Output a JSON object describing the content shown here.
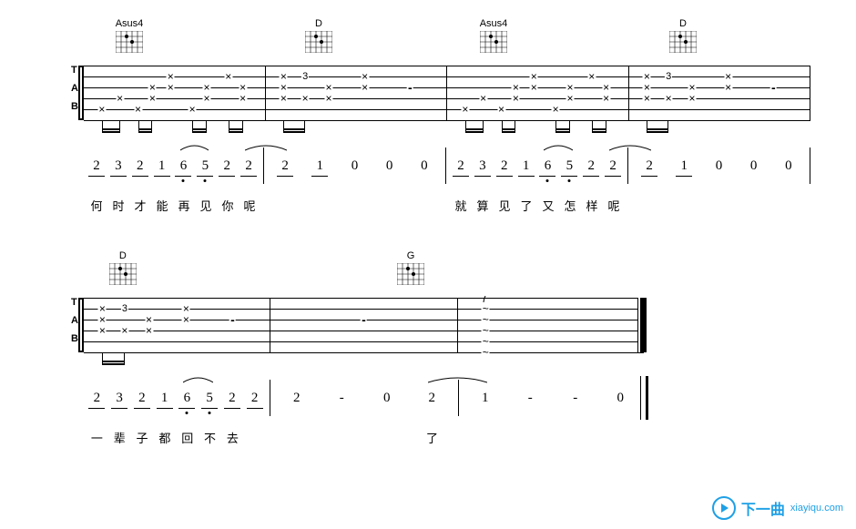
{
  "chart_data": {
    "type": "guitar_tab_with_jianpu",
    "systems": [
      {
        "chords": [
          {
            "position_pct": 4,
            "name": "Asus4"
          },
          {
            "position_pct": 30,
            "name": "D"
          },
          {
            "position_pct": 54,
            "name": "Asus4"
          },
          {
            "position_pct": 80,
            "name": "D"
          }
        ],
        "tab_measures": [
          {
            "marks": [
              {
                "x": 10,
                "string": 5,
                "t": "x"
              },
              {
                "x": 20,
                "string": 4,
                "t": "x"
              },
              {
                "x": 30,
                "string": 5,
                "t": "x"
              },
              {
                "x": 38,
                "string": 4,
                "t": "x"
              },
              {
                "x": 38,
                "string": 3,
                "t": "x"
              },
              {
                "x": 48,
                "string": 2,
                "t": "x"
              },
              {
                "x": 48,
                "string": 3,
                "t": "x"
              },
              {
                "x": 60,
                "string": 5,
                "t": "x"
              },
              {
                "x": 68,
                "string": 4,
                "t": "x"
              },
              {
                "x": 68,
                "string": 3,
                "t": "x"
              },
              {
                "x": 80,
                "string": 2,
                "t": "x"
              },
              {
                "x": 88,
                "string": 3,
                "t": "x"
              },
              {
                "x": 88,
                "string": 4,
                "t": "x"
              }
            ],
            "beams": [
              [
                10,
                20
              ],
              [
                30,
                38
              ],
              [
                60,
                68
              ],
              [
                80,
                88
              ]
            ]
          },
          {
            "marks": [
              {
                "x": 10,
                "string": 4,
                "t": "x"
              },
              {
                "x": 10,
                "string": 3,
                "t": "x"
              },
              {
                "x": 10,
                "string": 2,
                "t": "x"
              },
              {
                "x": 22,
                "string": 4,
                "t": "x"
              },
              {
                "x": 22,
                "string": 2,
                "t": "3"
              },
              {
                "x": 35,
                "string": 3,
                "t": "x"
              },
              {
                "x": 35,
                "string": 4,
                "t": "x"
              },
              {
                "x": 55,
                "string": 2,
                "t": "x"
              },
              {
                "x": 55,
                "string": 3,
                "t": "x"
              },
              {
                "x": 80,
                "string": 3,
                "t": "-"
              }
            ],
            "beams": [
              [
                10,
                22
              ]
            ]
          },
          {
            "marks": [
              {
                "x": 10,
                "string": 5,
                "t": "x"
              },
              {
                "x": 20,
                "string": 4,
                "t": "x"
              },
              {
                "x": 30,
                "string": 5,
                "t": "x"
              },
              {
                "x": 38,
                "string": 4,
                "t": "x"
              },
              {
                "x": 38,
                "string": 3,
                "t": "x"
              },
              {
                "x": 48,
                "string": 2,
                "t": "x"
              },
              {
                "x": 48,
                "string": 3,
                "t": "x"
              },
              {
                "x": 60,
                "string": 5,
                "t": "x"
              },
              {
                "x": 68,
                "string": 4,
                "t": "x"
              },
              {
                "x": 68,
                "string": 3,
                "t": "x"
              },
              {
                "x": 80,
                "string": 2,
                "t": "x"
              },
              {
                "x": 88,
                "string": 3,
                "t": "x"
              },
              {
                "x": 88,
                "string": 4,
                "t": "x"
              }
            ],
            "beams": [
              [
                10,
                20
              ],
              [
                30,
                38
              ],
              [
                60,
                68
              ],
              [
                80,
                88
              ]
            ]
          },
          {
            "marks": [
              {
                "x": 10,
                "string": 4,
                "t": "x"
              },
              {
                "x": 10,
                "string": 3,
                "t": "x"
              },
              {
                "x": 10,
                "string": 2,
                "t": "x"
              },
              {
                "x": 22,
                "string": 4,
                "t": "x"
              },
              {
                "x": 22,
                "string": 2,
                "t": "3"
              },
              {
                "x": 35,
                "string": 3,
                "t": "x"
              },
              {
                "x": 35,
                "string": 4,
                "t": "x"
              },
              {
                "x": 55,
                "string": 2,
                "t": "x"
              },
              {
                "x": 55,
                "string": 3,
                "t": "x"
              },
              {
                "x": 80,
                "string": 3,
                "t": "-"
              }
            ],
            "beams": [
              [
                10,
                22
              ]
            ]
          }
        ],
        "jianpu_measures": [
          {
            "notes": [
              {
                "n": "2",
                "u": 1
              },
              {
                "n": "3",
                "u": 1
              },
              {
                "n": "2",
                "u": 1
              },
              {
                "n": "1",
                "u": 1
              },
              {
                "n": "6",
                "u": 1,
                "low": 1,
                "tie_from": true
              },
              {
                "n": "5",
                "u": 1,
                "low": 1
              },
              {
                "n": "2",
                "u": 1
              },
              {
                "n": "2",
                "u": 1,
                "tie_to": true
              }
            ]
          },
          {
            "notes": [
              {
                "n": "2",
                "u": 1,
                "tie_from_prev": true
              },
              {
                "n": "1",
                "u": 1
              },
              {
                "n": "0"
              },
              {
                "n": "0"
              },
              {
                "n": "0"
              }
            ]
          },
          {
            "notes": [
              {
                "n": "2",
                "u": 1
              },
              {
                "n": "3",
                "u": 1
              },
              {
                "n": "2",
                "u": 1
              },
              {
                "n": "1",
                "u": 1
              },
              {
                "n": "6",
                "u": 1,
                "low": 1,
                "tie_from": true
              },
              {
                "n": "5",
                "u": 1,
                "low": 1
              },
              {
                "n": "2",
                "u": 1
              },
              {
                "n": "2",
                "u": 1,
                "tie_to": true
              }
            ]
          },
          {
            "notes": [
              {
                "n": "2",
                "u": 1,
                "tie_from_prev": true
              },
              {
                "n": "1",
                "u": 1
              },
              {
                "n": "0"
              },
              {
                "n": "0"
              },
              {
                "n": "0"
              }
            ]
          }
        ],
        "lyrics": [
          [
            "何",
            "时",
            "才",
            "能",
            "再",
            "见",
            "你",
            "呢"
          ],
          [
            "",
            "",
            "",
            "",
            ""
          ],
          [
            "就",
            "算",
            "见",
            "了",
            "又",
            "怎",
            "样",
            "呢"
          ],
          [
            "",
            "",
            "",
            "",
            ""
          ]
        ]
      },
      {
        "chords": [
          {
            "position_pct": 4,
            "name": "D"
          },
          {
            "position_pct": 55,
            "name": "G"
          }
        ],
        "tab_measures": [
          {
            "marks": [
              {
                "x": 10,
                "string": 4,
                "t": "x"
              },
              {
                "x": 10,
                "string": 3,
                "t": "x"
              },
              {
                "x": 10,
                "string": 2,
                "t": "x"
              },
              {
                "x": 22,
                "string": 4,
                "t": "x"
              },
              {
                "x": 22,
                "string": 2,
                "t": "3"
              },
              {
                "x": 35,
                "string": 3,
                "t": "x"
              },
              {
                "x": 35,
                "string": 4,
                "t": "x"
              },
              {
                "x": 55,
                "string": 2,
                "t": "x"
              },
              {
                "x": 55,
                "string": 3,
                "t": "x"
              },
              {
                "x": 80,
                "string": 3,
                "t": "-"
              }
            ],
            "beams": [
              [
                10,
                22
              ]
            ]
          },
          {
            "marks": [
              {
                "x": 50,
                "string": 3,
                "t": "-"
              }
            ],
            "beams": []
          },
          {
            "marks": [
              {
                "x": 15,
                "string": 1,
                "t": "~",
                "arpeggio": true
              },
              {
                "x": 15,
                "string": 2,
                "t": "~"
              },
              {
                "x": 15,
                "string": 3,
                "t": "~"
              },
              {
                "x": 15,
                "string": 4,
                "t": "~"
              },
              {
                "x": 15,
                "string": 5,
                "t": "~"
              },
              {
                "x": 15,
                "string": 6,
                "t": "~"
              }
            ],
            "beams": []
          }
        ],
        "jianpu_measures": [
          {
            "notes": [
              {
                "n": "2",
                "u": 1
              },
              {
                "n": "3",
                "u": 1
              },
              {
                "n": "2",
                "u": 1
              },
              {
                "n": "1",
                "u": 1
              },
              {
                "n": "6",
                "u": 1,
                "low": 1,
                "tie_from": true
              },
              {
                "n": "5",
                "u": 1,
                "low": 1
              },
              {
                "n": "2",
                "u": 1
              },
              {
                "n": "2",
                "u": 1
              }
            ]
          },
          {
            "notes": [
              {
                "n": "2"
              },
              {
                "n": "-"
              },
              {
                "n": "0"
              },
              {
                "n": "2",
                "tie_to": true
              }
            ]
          },
          {
            "notes": [
              {
                "n": "1"
              },
              {
                "n": "-"
              },
              {
                "n": "-"
              },
              {
                "n": "0"
              }
            ],
            "final": true
          }
        ],
        "lyrics": [
          [
            "一",
            "辈",
            "子",
            "都",
            "回",
            "不",
            "去",
            ""
          ],
          [
            "",
            "",
            "",
            "了"
          ],
          [
            "",
            "",
            "",
            ""
          ]
        ]
      }
    ]
  },
  "watermark": {
    "cn": "下一曲",
    "en": "xiayiqu.com"
  }
}
